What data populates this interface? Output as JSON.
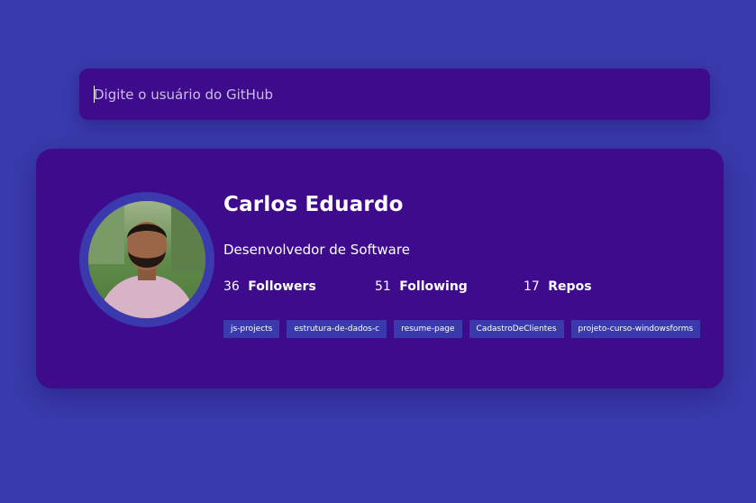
{
  "search": {
    "placeholder": "Digite o usuário do GitHub",
    "value": ""
  },
  "profile": {
    "name": "Carlos Eduardo",
    "bio": "Desenvolvedor de Software",
    "avatar_alt": "avatar-photo",
    "stats": {
      "followers": {
        "count": "36",
        "label": "Followers"
      },
      "following": {
        "count": "51",
        "label": "Following"
      },
      "repos": {
        "count": "17",
        "label": "Repos"
      }
    },
    "repositories": [
      "js-projects",
      "estrutura-de-dados-c",
      "resume-page",
      "CadastroDeClientes",
      "projeto-curso-windowsforms"
    ]
  },
  "colors": {
    "background": "#3a3aae",
    "card": "#3d0b8c",
    "tag": "#3a3aae",
    "text": "#ffffff"
  }
}
